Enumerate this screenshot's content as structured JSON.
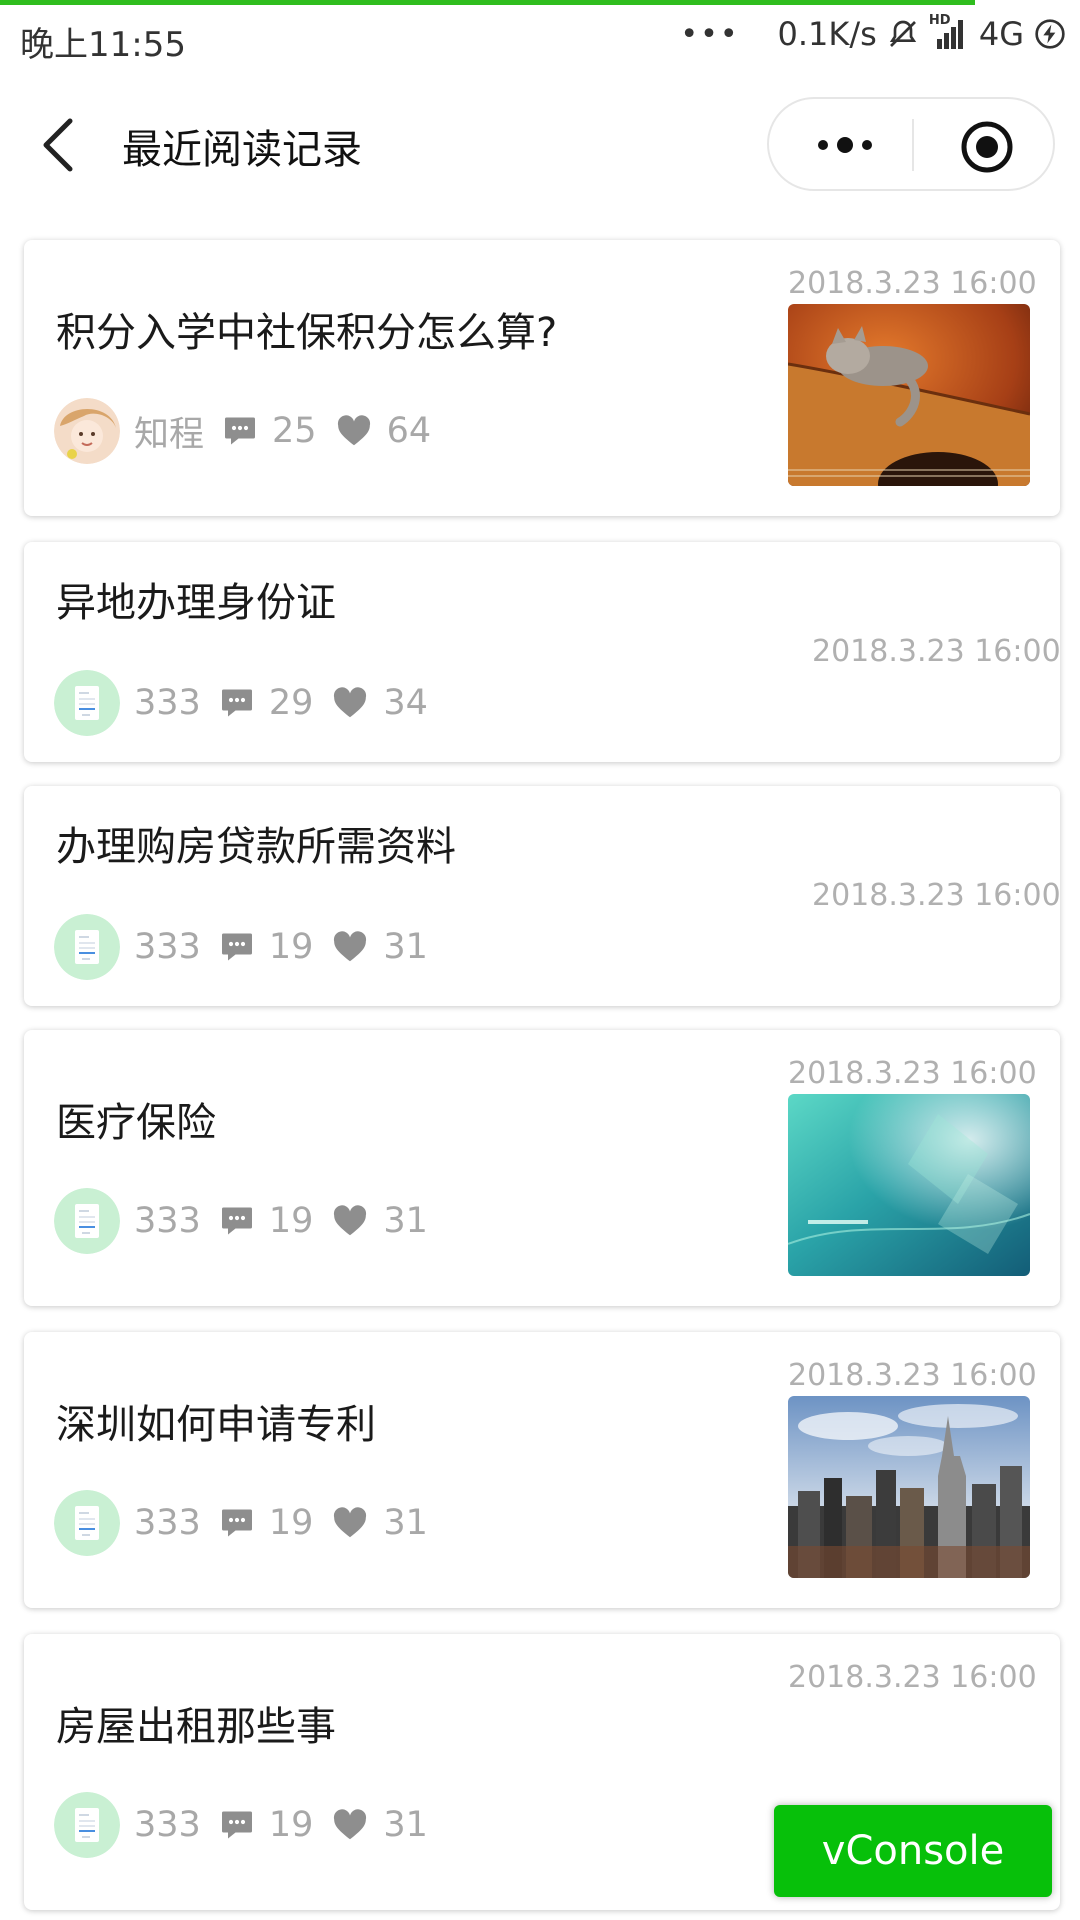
{
  "status_bar": {
    "time": "晚上11:55",
    "speed": "0.1K/s",
    "network": "4G",
    "hd": "HD"
  },
  "navbar": {
    "title": "最近阅读记录"
  },
  "articles": [
    {
      "title": "积分入学中社保积分怎么算?",
      "date": "2018.3.23 16:00",
      "author": "知程",
      "comments": "25",
      "likes": "64",
      "thumbnail": "kitten-on-guitar"
    },
    {
      "title": "异地办理身份证",
      "date": "2018.3.23 16:00",
      "author": "333",
      "comments": "29",
      "likes": "34"
    },
    {
      "title": "办理购房贷款所需资料",
      "date": "2018.3.23 16:00",
      "author": "333",
      "comments": "19",
      "likes": "31"
    },
    {
      "title": "医疗保险",
      "date": "2018.3.23 16:00",
      "author": "333",
      "comments": "19",
      "likes": "31",
      "thumbnail": "teal-abstract"
    },
    {
      "title": "深圳如何申请专利",
      "date": "2018.3.23 16:00",
      "author": "333",
      "comments": "19",
      "likes": "31",
      "thumbnail": "city-skyline"
    },
    {
      "title": "房屋出租那些事",
      "date": "2018.3.23 16:00",
      "author": "333",
      "comments": "19",
      "likes": "31"
    }
  ],
  "vconsole": {
    "label": "vConsole"
  },
  "colors": {
    "accent": "#07c00a",
    "progress": "#2fbd1e",
    "meta_text": "#a8a8a8",
    "date_text": "#b0b0b0"
  }
}
